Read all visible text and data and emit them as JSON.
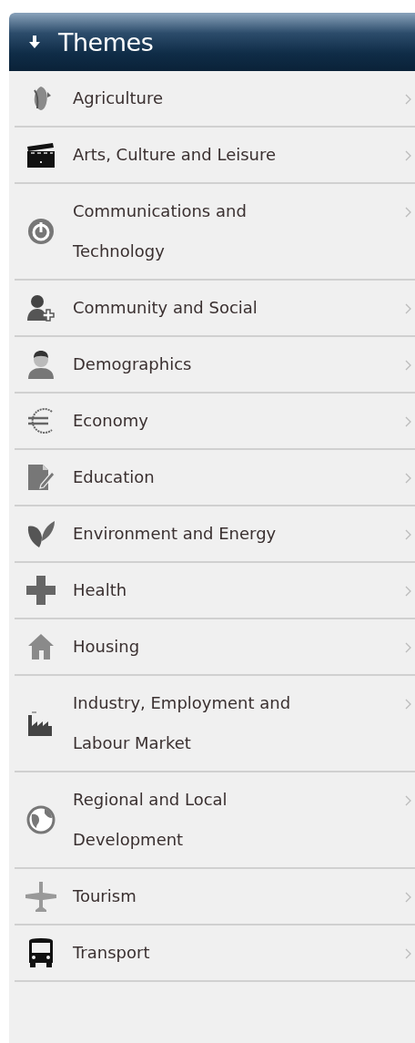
{
  "panel": {
    "title": "Themes",
    "expanded": true
  },
  "items": [
    {
      "label": "Agriculture"
    },
    {
      "label": "Arts, Culture and Leisure"
    },
    {
      "label": "Communications and Technology"
    },
    {
      "label": "Community and Social"
    },
    {
      "label": "Demographics"
    },
    {
      "label": "Economy"
    },
    {
      "label": "Education"
    },
    {
      "label": "Environment and Energy"
    },
    {
      "label": "Health"
    },
    {
      "label": "Housing"
    },
    {
      "label": "Industry, Employment and Labour Market"
    },
    {
      "label": "Regional and Local Development"
    },
    {
      "label": "Tourism"
    },
    {
      "label": "Transport"
    }
  ]
}
